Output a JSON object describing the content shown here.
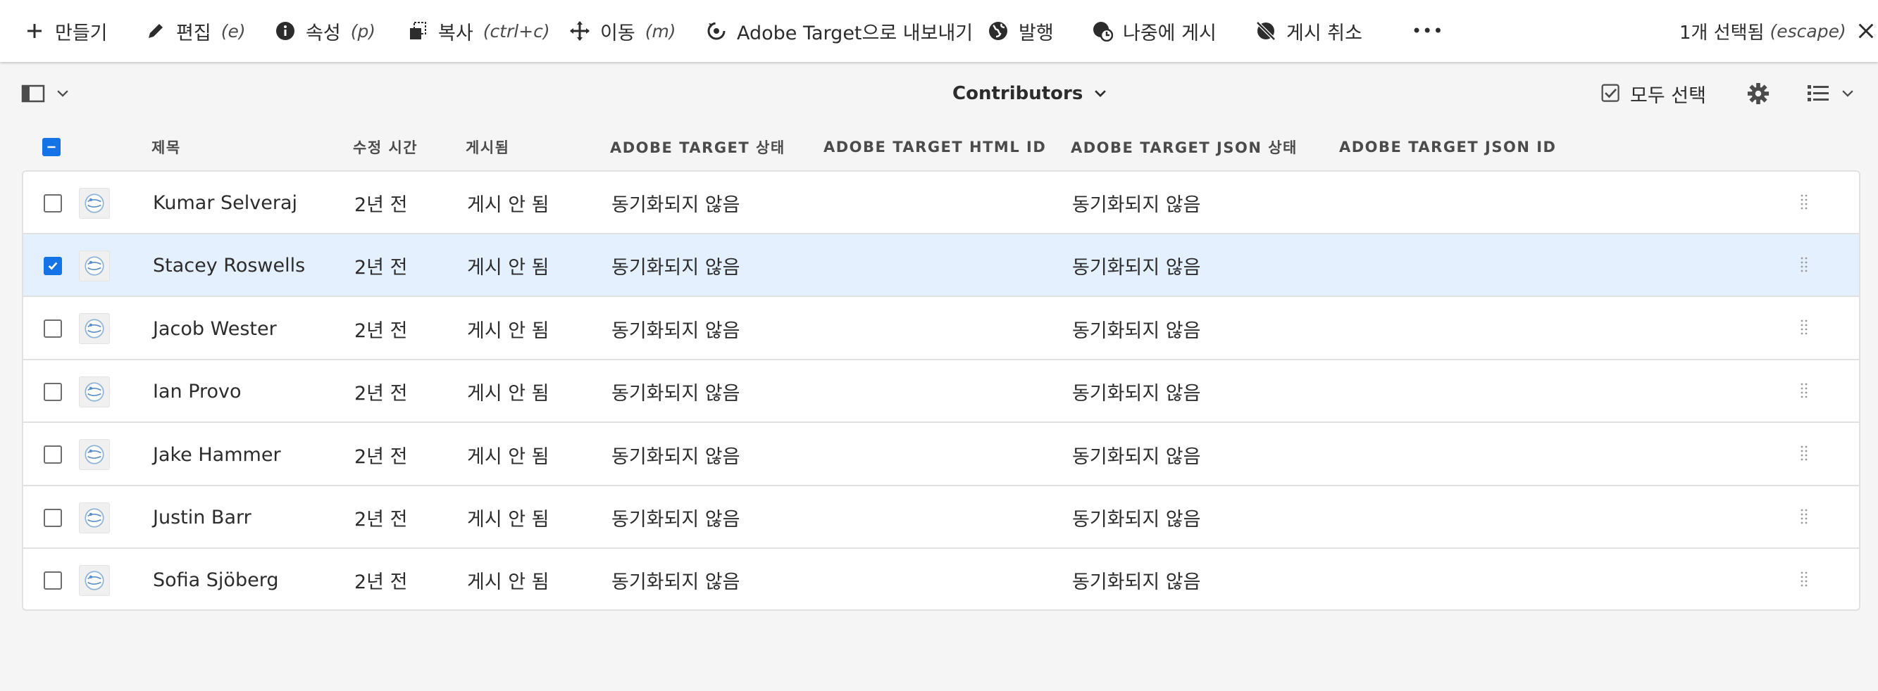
{
  "actionbar": {
    "create": "만들기",
    "edit": "편집",
    "edit_kbd": "(e)",
    "properties": "속성",
    "properties_kbd": "(p)",
    "copy": "복사",
    "copy_kbd": "(ctrl+c)",
    "move": "이동",
    "move_kbd": "(m)",
    "export_target": "Adobe Target으로 내보내기",
    "publish": "발행",
    "publish_later": "나중에 게시",
    "unpublish": "게시 취소",
    "more": "•••",
    "selection_status": "1개 선택됨",
    "selection_kbd": "(escape)"
  },
  "subbar": {
    "collection_title": "Contributors",
    "select_all": "모두 선택"
  },
  "table": {
    "columns": [
      "제목",
      "수정 시간",
      "게시됨",
      "ADOBE TARGET 상태",
      "ADOBE TARGET HTML ID",
      "ADOBE TARGET JSON 상태",
      "ADOBE TARGET JSON ID"
    ],
    "rows": [
      {
        "title": "Kumar Selveraj",
        "modified": "2년 전",
        "published": "게시 안 됨",
        "target_status": "동기화되지 않음",
        "html_id": "",
        "json_status": "동기화되지 않음",
        "json_id": "",
        "selected": false
      },
      {
        "title": "Stacey Roswells",
        "modified": "2년 전",
        "published": "게시 안 됨",
        "target_status": "동기화되지 않음",
        "html_id": "",
        "json_status": "동기화되지 않음",
        "json_id": "",
        "selected": true
      },
      {
        "title": "Jacob Wester",
        "modified": "2년 전",
        "published": "게시 안 됨",
        "target_status": "동기화되지 않음",
        "html_id": "",
        "json_status": "동기화되지 않음",
        "json_id": "",
        "selected": false
      },
      {
        "title": "Ian Provo",
        "modified": "2년 전",
        "published": "게시 안 됨",
        "target_status": "동기화되지 않음",
        "html_id": "",
        "json_status": "동기화되지 않음",
        "json_id": "",
        "selected": false
      },
      {
        "title": "Jake Hammer",
        "modified": "2년 전",
        "published": "게시 안 됨",
        "target_status": "동기화되지 않음",
        "html_id": "",
        "json_status": "동기화되지 않음",
        "json_id": "",
        "selected": false
      },
      {
        "title": "Justin Barr",
        "modified": "2년 전",
        "published": "게시 안 됨",
        "target_status": "동기화되지 않음",
        "html_id": "",
        "json_status": "동기화되지 않음",
        "json_id": "",
        "selected": false
      },
      {
        "title": "Sofia Sjöberg",
        "modified": "2년 전",
        "published": "게시 안 됨",
        "target_status": "동기화되지 않음",
        "html_id": "",
        "json_status": "동기화되지 않음",
        "json_id": "",
        "selected": false
      }
    ]
  },
  "colors": {
    "accent": "#1473e6",
    "selected_row": "#e5f0fe",
    "background": "#f5f5f5"
  }
}
